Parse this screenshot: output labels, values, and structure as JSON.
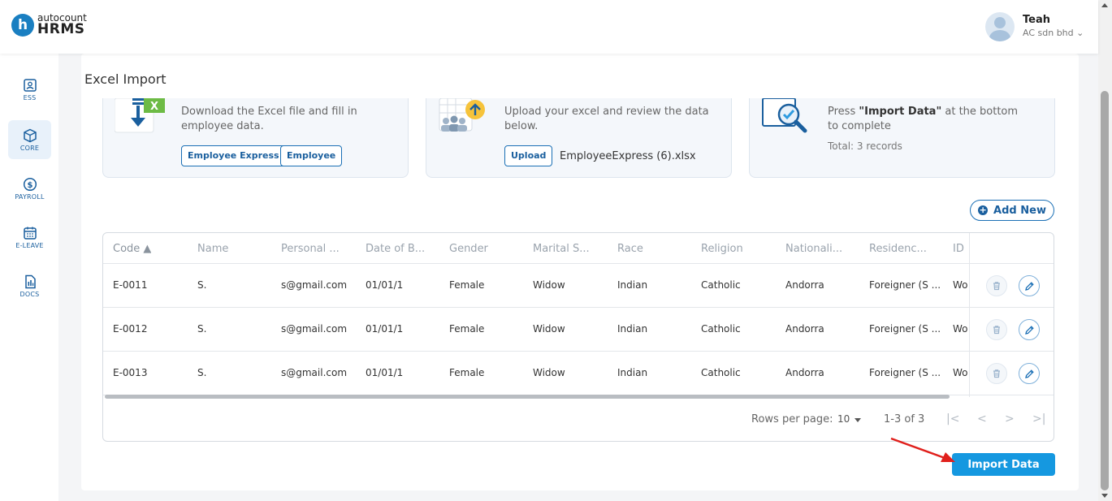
{
  "brand": {
    "logo_letter": "h",
    "auto": "autocount",
    "name": "HRMS"
  },
  "user": {
    "name": "Teah",
    "company": "AC sdn bhd ⌄"
  },
  "sidebar": {
    "items": [
      {
        "label": "ESS",
        "icon": "id-card-icon"
      },
      {
        "label": "CORE",
        "icon": "cube-icon",
        "active": true
      },
      {
        "label": "PAYROLL",
        "icon": "dollar-icon"
      },
      {
        "label": "E-LEAVE",
        "icon": "calendar-icon"
      },
      {
        "label": "DOCS",
        "icon": "document-icon"
      }
    ]
  },
  "page": {
    "title": "Excel Import"
  },
  "steps": [
    {
      "text": "Download the Excel file and fill in employee data.",
      "buttons": [
        "Employee Express",
        "Employee"
      ],
      "icon": "excel-download-icon"
    },
    {
      "text": "Upload your excel and review the data below.",
      "button": "Upload",
      "filename": "EmployeeExpress (6).xlsx",
      "icon": "upload-users-icon"
    },
    {
      "text_bold": "\"Import Data\"",
      "text_pre": "Press ",
      "text_post": " at the bottom to complete",
      "total": "Total: 3 records",
      "icon": "review-magnifier-icon"
    }
  ],
  "add_new_label": "Add New",
  "table": {
    "columns": [
      "Code ▲",
      "Name",
      "Personal ...",
      "Date of B...",
      "Gender",
      "Marital S...",
      "Race",
      "Religion",
      "Nationali...",
      "Residenc...",
      "ID T"
    ],
    "rows": [
      [
        "E-0011",
        "S.",
        "s@gmail.com",
        "01/01/1",
        "Female",
        "Widow",
        "Indian",
        "Catholic",
        "Andorra",
        "Foreigner (S ...",
        "Wo"
      ],
      [
        "E-0012",
        "S.",
        "s@gmail.com",
        "01/01/1",
        "Female",
        "Widow",
        "Indian",
        "Catholic",
        "Andorra",
        "Foreigner (S ...",
        "Wo"
      ],
      [
        "E-0013",
        "S.",
        "s@gmail.com",
        "01/01/1",
        "Female",
        "Widow",
        "Indian",
        "Catholic",
        "Andorra",
        "Foreigner (S ...",
        "Wo"
      ]
    ]
  },
  "pager": {
    "rows_label": "Rows per page:",
    "rows_value": "10",
    "range": "1-3 of 3"
  },
  "import_button": "Import Data",
  "colors": {
    "accent": "#1598e0",
    "brand": "#1a5f9e",
    "annotation": "#e0201c"
  }
}
